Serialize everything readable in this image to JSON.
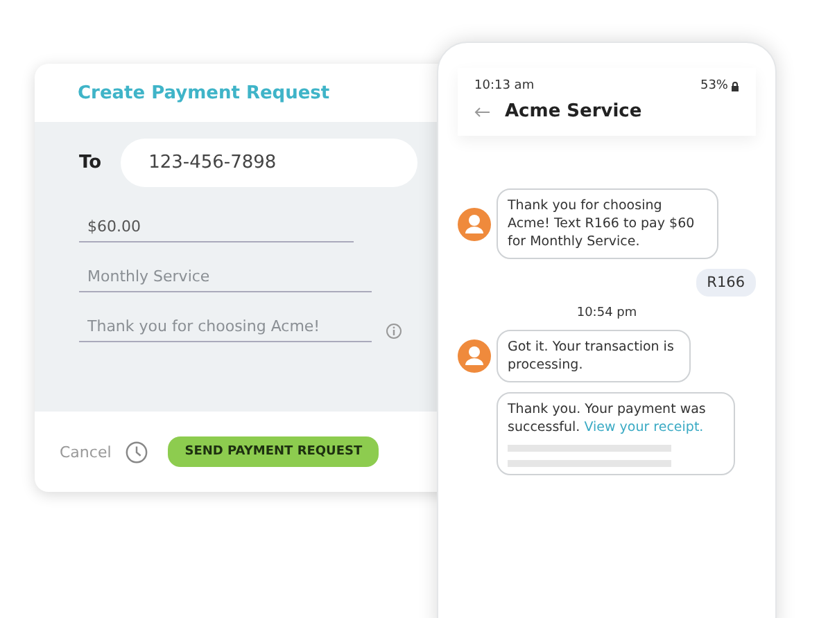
{
  "payment_form": {
    "title": "Create Payment Request",
    "to_label": "To",
    "to_value": "123-456-7898",
    "fields": [
      {
        "value": "$60.00",
        "has_info": false
      },
      {
        "placeholder": "Monthly Service",
        "has_info": false
      },
      {
        "placeholder": "Thank you for choosing Acme!",
        "has_info": true
      }
    ],
    "cancel": "Cancel",
    "submit": "SEND PAYMENT REQUEST"
  },
  "phone": {
    "time": "10:13 am",
    "battery": "53%",
    "title": "Acme Service",
    "messages": [
      {
        "kind": "incoming",
        "avatar": true,
        "text": "Thank you for choosing Acme! Text R166 to pay $60 for Monthly Service."
      },
      {
        "kind": "outgoing",
        "text": "R166"
      },
      {
        "kind": "timestamp",
        "text": "10:54 pm"
      },
      {
        "kind": "incoming",
        "avatar": true,
        "text": "Got it. Your transaction is processing."
      },
      {
        "kind": "incoming",
        "avatar": false,
        "text": "Thank you. Your payment was successful.",
        "link": "View your receipt.",
        "preview": true
      }
    ]
  }
}
